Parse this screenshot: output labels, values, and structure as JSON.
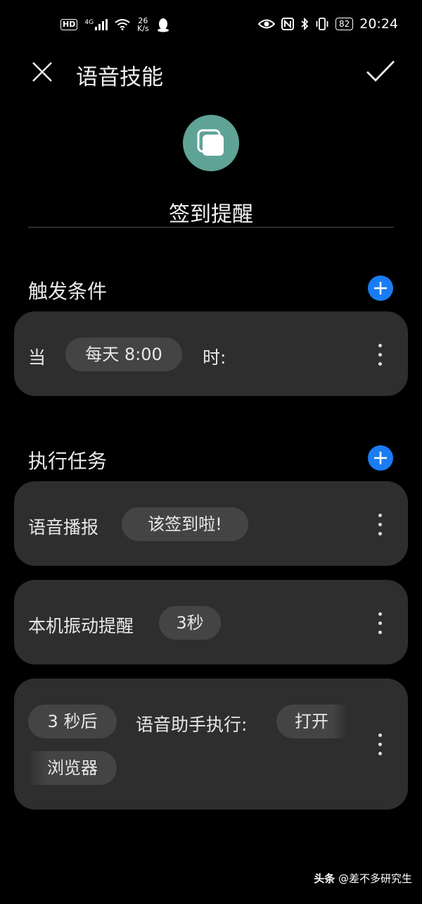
{
  "status_bar": {
    "hd": "HD",
    "signal": "4G",
    "net_speed_value": "26",
    "net_speed_unit": "K/s",
    "battery": "82",
    "time": "20:24"
  },
  "header": {
    "title": "语音技能",
    "close_icon": "close-icon",
    "confirm_icon": "check-icon"
  },
  "skill": {
    "icon": "stacked-squares-icon",
    "icon_color": "#5fa296",
    "name": "签到提醒"
  },
  "trigger": {
    "section_title": "触发条件",
    "prefix": "当",
    "time_chip": "每天 8:00",
    "suffix": "时:"
  },
  "tasks": {
    "section_title": "执行任务",
    "items": [
      {
        "label": "语音播报",
        "chip": "该签到啦!"
      },
      {
        "label": "本机振动提醒",
        "chip": "3秒"
      },
      {
        "chip_delay": "3 秒后",
        "label": "语音助手执行:",
        "chip_action": "打开",
        "chip_target": "浏览器"
      }
    ]
  },
  "colors": {
    "accent": "#1a7cf4",
    "card": "#2e2e2e",
    "chip": "#444444"
  },
  "watermark": {
    "brand": "头条",
    "author": "@差不多研究生"
  }
}
